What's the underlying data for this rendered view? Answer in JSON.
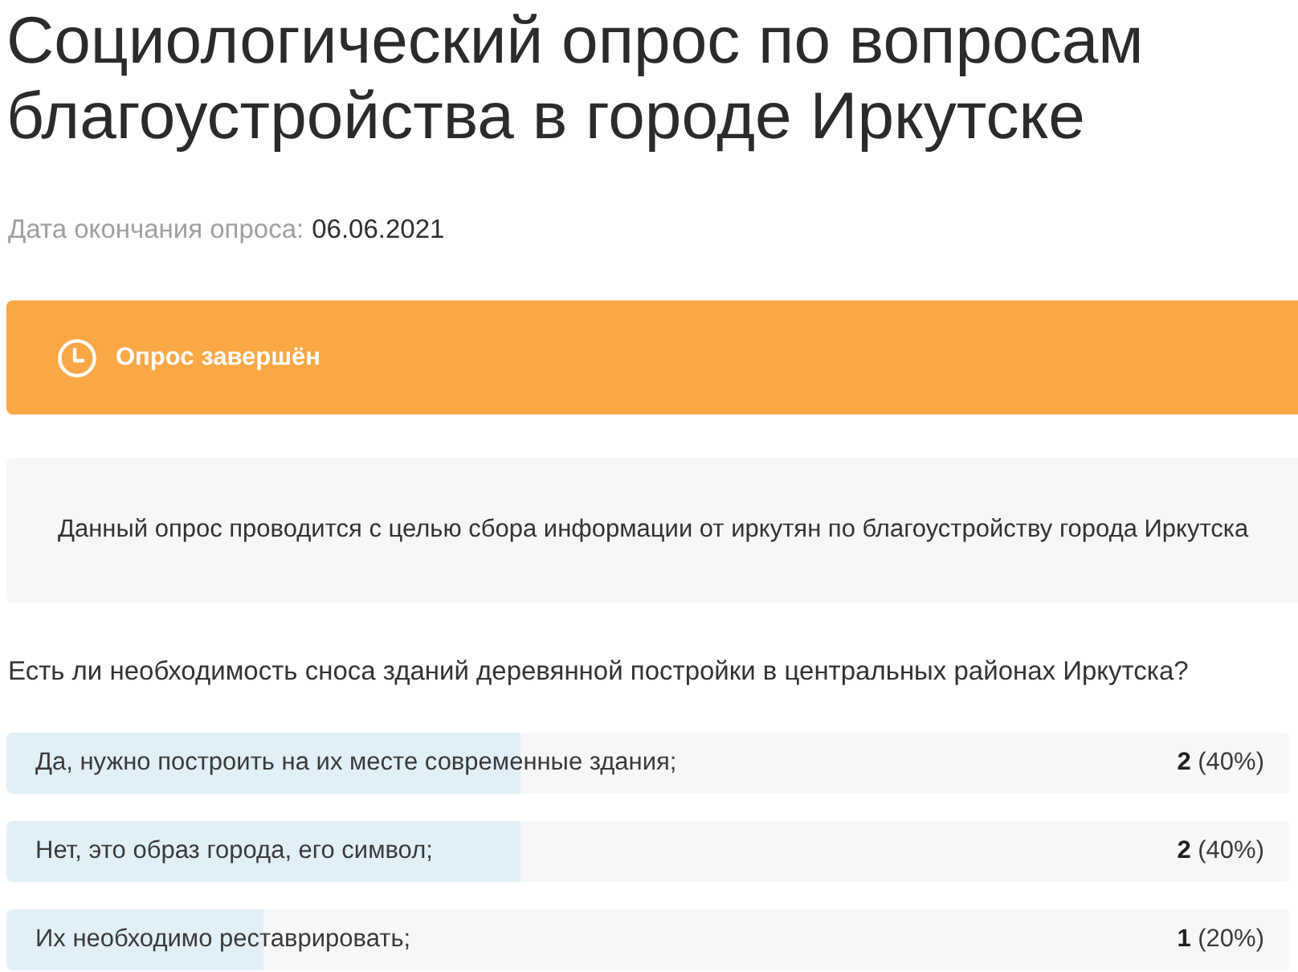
{
  "title": "Социологический опрос по вопросам благоустройства в городе Иркутске",
  "end_date": {
    "label": "Дата окончания опроса:",
    "value": "06.06.2021"
  },
  "status_banner": {
    "text": "Опрос завершён"
  },
  "description": "Данный опрос проводится с целью сбора информации от иркутян по благоустройству города Иркутска",
  "question": {
    "text": "Есть ли необходимость сноса зданий деревянной постройки в центральных районах Иркутска?",
    "answers": [
      {
        "label": "Да, нужно построить на их месте современные здания;",
        "result": "**2** (40%)",
        "level": 0.4
      },
      {
        "label": "Нет, это образ города, его символ;",
        "result": "**2** (40%)",
        "level": 0.4
      },
      {
        "label": "Их необходимо реставрировать;",
        "result": "**1** (20%)",
        "level": 0.2
      }
    ]
  }
}
